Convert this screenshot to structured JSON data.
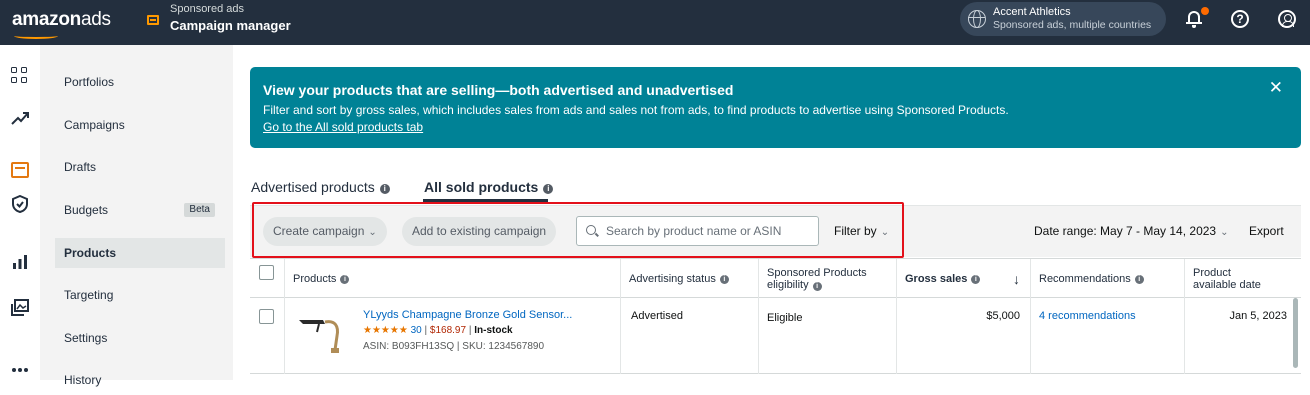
{
  "topbar": {
    "logo_main": "amazon",
    "logo_sub": "ads",
    "app_subtitle": "Sponsored ads",
    "app_title": "Campaign manager",
    "account_name": "Accent Athletics",
    "account_desc": "Sponsored ads, multiple countries",
    "help_glyph": "?",
    "icons": [
      "globe-icon",
      "bell-icon",
      "help-icon",
      "user-icon"
    ],
    "notification_color": "#ff6b00"
  },
  "sidebar": {
    "items": [
      {
        "label": "Portfolios"
      },
      {
        "label": "Campaigns"
      },
      {
        "label": "Drafts"
      },
      {
        "label": "Budgets",
        "badge": "Beta"
      },
      {
        "label": "Products",
        "active": true
      },
      {
        "label": "Targeting"
      },
      {
        "label": "Settings"
      },
      {
        "label": "History"
      }
    ]
  },
  "banner": {
    "title": "View your products that are selling—both advertised and unadvertised",
    "body": "Filter and sort by gross sales, which includes sales from ads and sales not from ads, to find products to advertise using Sponsored Products.",
    "link": "Go to the All sold products tab",
    "close": "✕",
    "color": "#008296"
  },
  "tabs": [
    {
      "label": "Advertised products"
    },
    {
      "label": "All sold products",
      "active": true
    }
  ],
  "toolbar": {
    "create_campaign": "Create campaign",
    "add_existing": "Add to existing campaign",
    "search_placeholder": "Search by product name or ASIN",
    "filter_by": "Filter by",
    "date_range": "Date range: May 7 - May 14, 2023",
    "export": "Export"
  },
  "table": {
    "columns": {
      "products": "Products",
      "advertising_status": "Advertising status",
      "sp_eligibility_1": "Sponsored Products",
      "sp_eligibility_2": "eligibility",
      "gross_sales": "Gross sales",
      "sort_arrow": "↓",
      "recommendations": "Recommendations",
      "available_date_1": "Product",
      "available_date_2": "available date"
    },
    "rows": [
      {
        "name": "YLyyds Champagne Bronze Gold Sensor...",
        "stars": "★★★★★",
        "rating_count": "30",
        "price": "$168.97",
        "stock": "In-stock",
        "asin_sku": "ASIN: B093FH13SQ | SKU: 1234567890",
        "advertising_status": "Advertised",
        "eligibility": "Eligible",
        "gross_sales": "$5,000",
        "recommendations": "4 recommendations",
        "available_date": "Jan 5, 2023"
      }
    ]
  }
}
